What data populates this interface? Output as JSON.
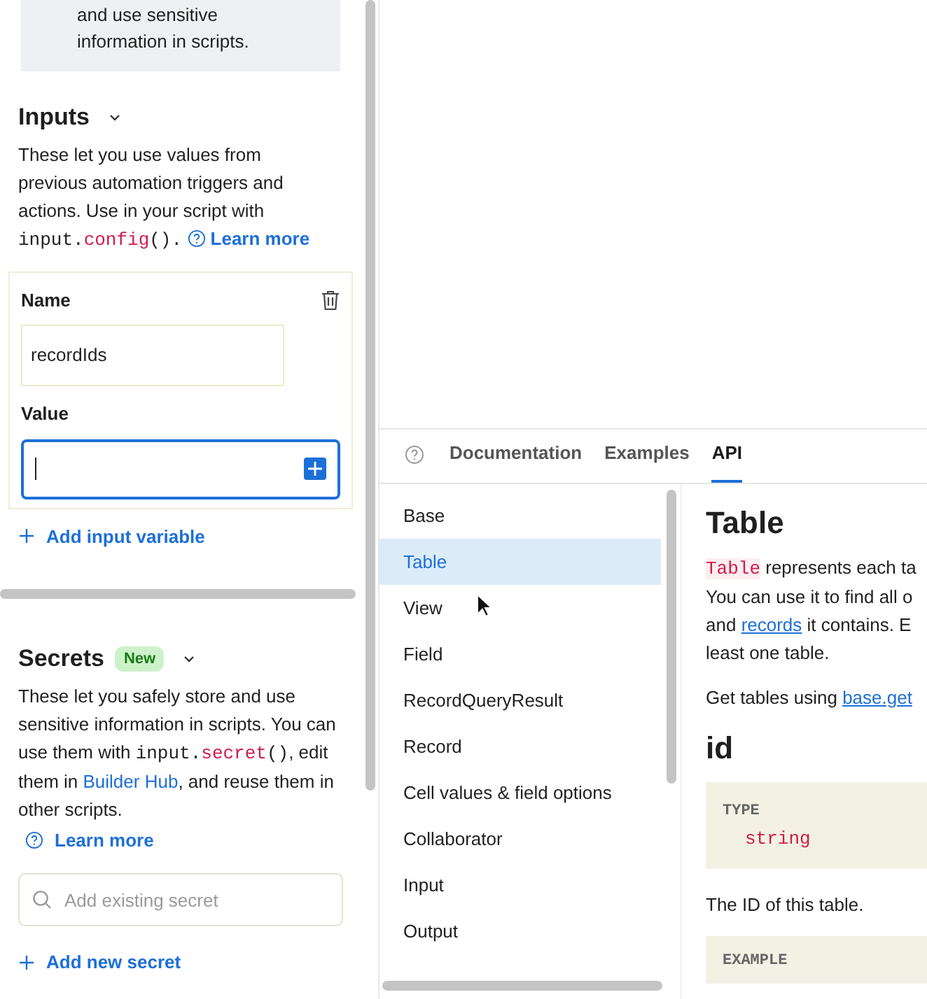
{
  "notice": {
    "lines": [
      "and use sensitive",
      "information in scripts."
    ]
  },
  "inputs": {
    "title": "Inputs",
    "expanded": true,
    "text": "These let you use values from previous automation triggers and actions. Use in your script with ",
    "code_object": "input.",
    "code_method": "config",
    "code_suffix": "().",
    "link": "Learn more",
    "variable": {
      "name_label": "Name",
      "name_value": "recordIds",
      "value_label": "Value",
      "value_focused": true
    },
    "add": "Add input variable"
  },
  "secrets": {
    "title": "Secrets",
    "badge": "New",
    "expanded": true,
    "text_before": "These let you safely store and use sensitive information in scripts. You can use them with ",
    "code_object": "input.",
    "code_method": "secret",
    "code_suffix": "()",
    "text_middle": ", edit them in ",
    "hub_link": "Builder Hub",
    "text_after": ", and reuse them in other scripts.",
    "link": "Learn more",
    "search_placeholder": "Add existing secret",
    "add": "Add new secret"
  },
  "docs": {
    "tabs": [
      {
        "label": "Documentation",
        "selected": false
      },
      {
        "label": "Examples",
        "selected": false
      },
      {
        "label": "API",
        "selected": true
      }
    ],
    "nav": [
      {
        "label": "Base",
        "selected": false
      },
      {
        "label": "Table",
        "selected": true
      },
      {
        "label": "View",
        "selected": false
      },
      {
        "label": "Field",
        "selected": false
      },
      {
        "label": "RecordQueryResult",
        "selected": false
      },
      {
        "label": "Record",
        "selected": false
      },
      {
        "label": "Cell values & field options",
        "selected": false
      },
      {
        "label": "Collaborator",
        "selected": false
      },
      {
        "label": "Input",
        "selected": false
      },
      {
        "label": "Output",
        "selected": false
      }
    ],
    "article": {
      "title": "Table",
      "code": "Table",
      "line1": " represents each ta",
      "line2": "You can use it to find all o",
      "line3_before": "and ",
      "line3_link": "records",
      "line3_after": " it contains. E",
      "line4": "least one table.",
      "get_text": "Get tables using ",
      "get_link": "base.get",
      "heading": "id",
      "type_label": "TYPE",
      "type_value": "string",
      "description": "The ID of this table.",
      "example_label": "EXAMPLE"
    }
  }
}
